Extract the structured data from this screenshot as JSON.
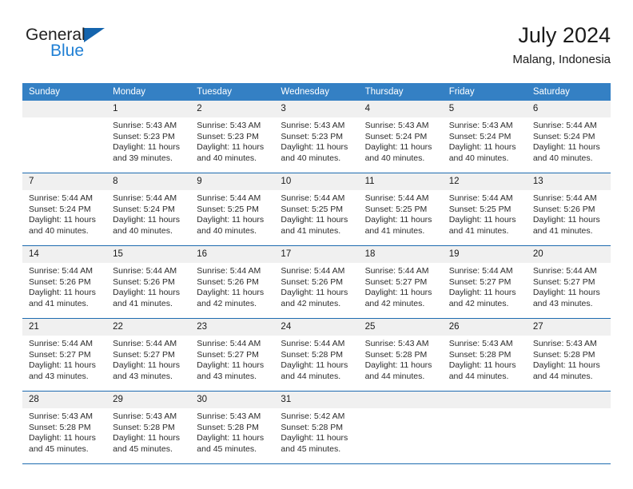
{
  "brand": {
    "line1": "General",
    "line2": "Blue",
    "icon": "triangle-logo"
  },
  "header": {
    "title": "July 2024",
    "subtitle": "Malang, Indonesia"
  },
  "colors": {
    "header_blue": "#3480c4",
    "divider_blue": "#1e6bb0",
    "brand_blue": "#1f7fd4",
    "logo_blue": "#1464ad",
    "daynum_bg": "#f0f0f0"
  },
  "weekdays": [
    "Sunday",
    "Monday",
    "Tuesday",
    "Wednesday",
    "Thursday",
    "Friday",
    "Saturday"
  ],
  "weeks": [
    [
      {
        "day": "",
        "sunrise": "",
        "sunset": "",
        "daylight1": "",
        "daylight2": ""
      },
      {
        "day": "1",
        "sunrise": "Sunrise: 5:43 AM",
        "sunset": "Sunset: 5:23 PM",
        "daylight1": "Daylight: 11 hours",
        "daylight2": "and 39 minutes."
      },
      {
        "day": "2",
        "sunrise": "Sunrise: 5:43 AM",
        "sunset": "Sunset: 5:23 PM",
        "daylight1": "Daylight: 11 hours",
        "daylight2": "and 40 minutes."
      },
      {
        "day": "3",
        "sunrise": "Sunrise: 5:43 AM",
        "sunset": "Sunset: 5:23 PM",
        "daylight1": "Daylight: 11 hours",
        "daylight2": "and 40 minutes."
      },
      {
        "day": "4",
        "sunrise": "Sunrise: 5:43 AM",
        "sunset": "Sunset: 5:24 PM",
        "daylight1": "Daylight: 11 hours",
        "daylight2": "and 40 minutes."
      },
      {
        "day": "5",
        "sunrise": "Sunrise: 5:43 AM",
        "sunset": "Sunset: 5:24 PM",
        "daylight1": "Daylight: 11 hours",
        "daylight2": "and 40 minutes."
      },
      {
        "day": "6",
        "sunrise": "Sunrise: 5:44 AM",
        "sunset": "Sunset: 5:24 PM",
        "daylight1": "Daylight: 11 hours",
        "daylight2": "and 40 minutes."
      }
    ],
    [
      {
        "day": "7",
        "sunrise": "Sunrise: 5:44 AM",
        "sunset": "Sunset: 5:24 PM",
        "daylight1": "Daylight: 11 hours",
        "daylight2": "and 40 minutes."
      },
      {
        "day": "8",
        "sunrise": "Sunrise: 5:44 AM",
        "sunset": "Sunset: 5:24 PM",
        "daylight1": "Daylight: 11 hours",
        "daylight2": "and 40 minutes."
      },
      {
        "day": "9",
        "sunrise": "Sunrise: 5:44 AM",
        "sunset": "Sunset: 5:25 PM",
        "daylight1": "Daylight: 11 hours",
        "daylight2": "and 40 minutes."
      },
      {
        "day": "10",
        "sunrise": "Sunrise: 5:44 AM",
        "sunset": "Sunset: 5:25 PM",
        "daylight1": "Daylight: 11 hours",
        "daylight2": "and 41 minutes."
      },
      {
        "day": "11",
        "sunrise": "Sunrise: 5:44 AM",
        "sunset": "Sunset: 5:25 PM",
        "daylight1": "Daylight: 11 hours",
        "daylight2": "and 41 minutes."
      },
      {
        "day": "12",
        "sunrise": "Sunrise: 5:44 AM",
        "sunset": "Sunset: 5:25 PM",
        "daylight1": "Daylight: 11 hours",
        "daylight2": "and 41 minutes."
      },
      {
        "day": "13",
        "sunrise": "Sunrise: 5:44 AM",
        "sunset": "Sunset: 5:26 PM",
        "daylight1": "Daylight: 11 hours",
        "daylight2": "and 41 minutes."
      }
    ],
    [
      {
        "day": "14",
        "sunrise": "Sunrise: 5:44 AM",
        "sunset": "Sunset: 5:26 PM",
        "daylight1": "Daylight: 11 hours",
        "daylight2": "and 41 minutes."
      },
      {
        "day": "15",
        "sunrise": "Sunrise: 5:44 AM",
        "sunset": "Sunset: 5:26 PM",
        "daylight1": "Daylight: 11 hours",
        "daylight2": "and 41 minutes."
      },
      {
        "day": "16",
        "sunrise": "Sunrise: 5:44 AM",
        "sunset": "Sunset: 5:26 PM",
        "daylight1": "Daylight: 11 hours",
        "daylight2": "and 42 minutes."
      },
      {
        "day": "17",
        "sunrise": "Sunrise: 5:44 AM",
        "sunset": "Sunset: 5:26 PM",
        "daylight1": "Daylight: 11 hours",
        "daylight2": "and 42 minutes."
      },
      {
        "day": "18",
        "sunrise": "Sunrise: 5:44 AM",
        "sunset": "Sunset: 5:27 PM",
        "daylight1": "Daylight: 11 hours",
        "daylight2": "and 42 minutes."
      },
      {
        "day": "19",
        "sunrise": "Sunrise: 5:44 AM",
        "sunset": "Sunset: 5:27 PM",
        "daylight1": "Daylight: 11 hours",
        "daylight2": "and 42 minutes."
      },
      {
        "day": "20",
        "sunrise": "Sunrise: 5:44 AM",
        "sunset": "Sunset: 5:27 PM",
        "daylight1": "Daylight: 11 hours",
        "daylight2": "and 43 minutes."
      }
    ],
    [
      {
        "day": "21",
        "sunrise": "Sunrise: 5:44 AM",
        "sunset": "Sunset: 5:27 PM",
        "daylight1": "Daylight: 11 hours",
        "daylight2": "and 43 minutes."
      },
      {
        "day": "22",
        "sunrise": "Sunrise: 5:44 AM",
        "sunset": "Sunset: 5:27 PM",
        "daylight1": "Daylight: 11 hours",
        "daylight2": "and 43 minutes."
      },
      {
        "day": "23",
        "sunrise": "Sunrise: 5:44 AM",
        "sunset": "Sunset: 5:27 PM",
        "daylight1": "Daylight: 11 hours",
        "daylight2": "and 43 minutes."
      },
      {
        "day": "24",
        "sunrise": "Sunrise: 5:44 AM",
        "sunset": "Sunset: 5:28 PM",
        "daylight1": "Daylight: 11 hours",
        "daylight2": "and 44 minutes."
      },
      {
        "day": "25",
        "sunrise": "Sunrise: 5:43 AM",
        "sunset": "Sunset: 5:28 PM",
        "daylight1": "Daylight: 11 hours",
        "daylight2": "and 44 minutes."
      },
      {
        "day": "26",
        "sunrise": "Sunrise: 5:43 AM",
        "sunset": "Sunset: 5:28 PM",
        "daylight1": "Daylight: 11 hours",
        "daylight2": "and 44 minutes."
      },
      {
        "day": "27",
        "sunrise": "Sunrise: 5:43 AM",
        "sunset": "Sunset: 5:28 PM",
        "daylight1": "Daylight: 11 hours",
        "daylight2": "and 44 minutes."
      }
    ],
    [
      {
        "day": "28",
        "sunrise": "Sunrise: 5:43 AM",
        "sunset": "Sunset: 5:28 PM",
        "daylight1": "Daylight: 11 hours",
        "daylight2": "and 45 minutes."
      },
      {
        "day": "29",
        "sunrise": "Sunrise: 5:43 AM",
        "sunset": "Sunset: 5:28 PM",
        "daylight1": "Daylight: 11 hours",
        "daylight2": "and 45 minutes."
      },
      {
        "day": "30",
        "sunrise": "Sunrise: 5:43 AM",
        "sunset": "Sunset: 5:28 PM",
        "daylight1": "Daylight: 11 hours",
        "daylight2": "and 45 minutes."
      },
      {
        "day": "31",
        "sunrise": "Sunrise: 5:42 AM",
        "sunset": "Sunset: 5:28 PM",
        "daylight1": "Daylight: 11 hours",
        "daylight2": "and 45 minutes."
      },
      {
        "day": "",
        "sunrise": "",
        "sunset": "",
        "daylight1": "",
        "daylight2": ""
      },
      {
        "day": "",
        "sunrise": "",
        "sunset": "",
        "daylight1": "",
        "daylight2": ""
      },
      {
        "day": "",
        "sunrise": "",
        "sunset": "",
        "daylight1": "",
        "daylight2": ""
      }
    ]
  ]
}
